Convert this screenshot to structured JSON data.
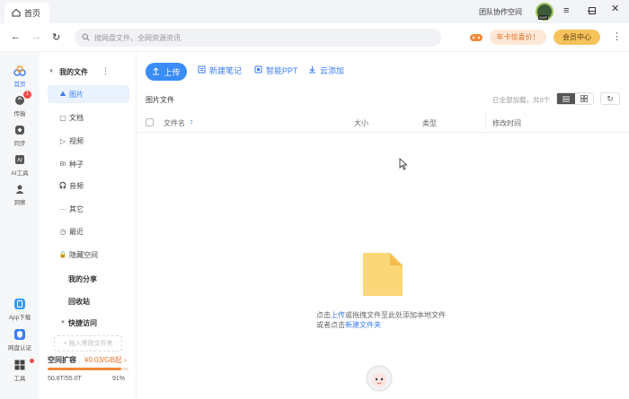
{
  "titlebar": {
    "tab_label": "首页",
    "team_space": "团队协作空间",
    "avatar_tag": "SVIP"
  },
  "toolbar": {
    "search_placeholder": "搜网盘文件、全网资源资讯",
    "promo": "年卡惊喜价！",
    "vip_center": "会员中心"
  },
  "leftbar": {
    "items": [
      {
        "label": "首页",
        "icon": "cloud-icon"
      },
      {
        "label": "传输",
        "icon": "transfer-icon",
        "badge": "1"
      },
      {
        "label": "同步",
        "icon": "sync-icon"
      },
      {
        "label": "AI工具",
        "icon": "ai-icon"
      },
      {
        "label": "洞察",
        "icon": "user-icon"
      }
    ],
    "bottom": [
      {
        "label": "App下载",
        "icon": "app-icon"
      },
      {
        "label": "网盘认证",
        "icon": "shield-icon"
      },
      {
        "label": "工具",
        "icon": "tools-icon"
      }
    ]
  },
  "sidebar": {
    "my_files": "我的文件",
    "items": [
      {
        "label": "图片",
        "icon": "image-icon",
        "glyph": "⛰"
      },
      {
        "label": "文档",
        "icon": "document-icon",
        "glyph": "▢"
      },
      {
        "label": "视频",
        "icon": "video-icon",
        "glyph": "▷"
      },
      {
        "label": "种子",
        "icon": "torrent-icon",
        "glyph": "Bt"
      },
      {
        "label": "音频",
        "icon": "audio-icon",
        "glyph": "🎧"
      },
      {
        "label": "其它",
        "icon": "more-icon",
        "glyph": "···"
      },
      {
        "label": "最近",
        "icon": "clock-icon",
        "glyph": "◷"
      },
      {
        "label": "隐藏空间",
        "icon": "lock-icon",
        "glyph": "🔒"
      }
    ],
    "my_share": "我的分享",
    "recycle": "回收站",
    "quick_access": "快捷访问",
    "add_quick": "+ 拖入常用文件夹",
    "storage_label": "空间扩容",
    "storage_price": "¥0.03/GB起 ›",
    "storage_used": "50.6T/55.0T",
    "storage_percent": "91%",
    "storage_fraction": 0.91
  },
  "main": {
    "upload": "上传",
    "new_note": "新建笔记",
    "smart_ppt": "智能PPT",
    "cloud_add": "云添加",
    "folder_title": "图片文件",
    "loaded_status": "已全部加载，共0个",
    "columns": [
      "文件名",
      "大小",
      "类型",
      "修改时间"
    ],
    "empty_line1_a": "点击",
    "empty_line1_link": "上传",
    "empty_line1_b": "或拖拽文件至此处添加本地文件",
    "empty_line2_a": "或者点击",
    "empty_line2_link": "新建文件夹"
  },
  "colors": {
    "accent": "#3a7cf5",
    "promo": "#e8732a",
    "vip": "#f6c35a"
  }
}
